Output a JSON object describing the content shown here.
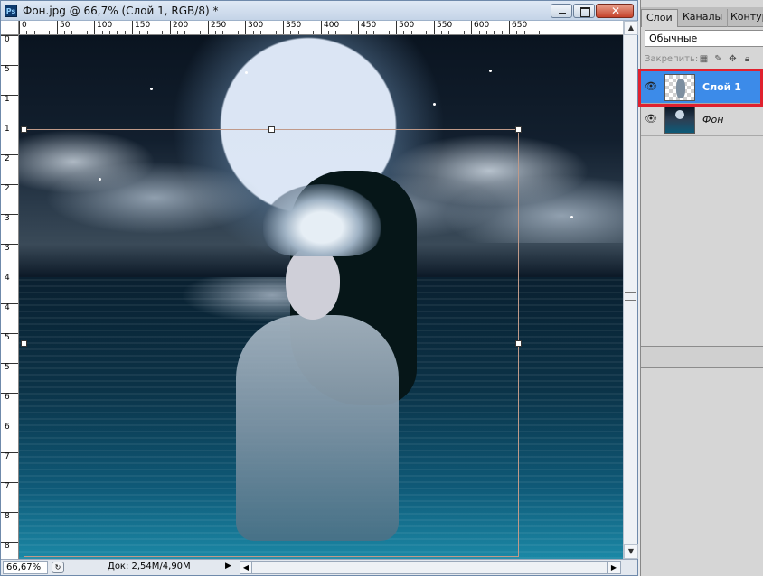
{
  "window": {
    "app_icon": "Ps",
    "title": "Фон.jpg @ 66,7% (Слой 1, RGB/8) *",
    "close_glyph": "✕"
  },
  "ruler": {
    "top_labels": [
      "0",
      "50",
      "100",
      "150",
      "200",
      "250",
      "300",
      "350",
      "400",
      "450",
      "500",
      "550",
      "600",
      "650"
    ],
    "left_labels": [
      "0",
      "5",
      "1",
      "1",
      "2",
      "2",
      "3",
      "3",
      "4",
      "4",
      "5",
      "5",
      "6",
      "6",
      "7",
      "7",
      "8",
      "8"
    ]
  },
  "main": {
    "canvas": {
      "background_image": "fantasy-moon-sea-woman",
      "colors": {
        "transform_border": "#c09a8a"
      }
    }
  },
  "status": {
    "zoom": "66,67%",
    "doc_info": "Док: 2,54M/4,90M",
    "menu_arrow": "▶",
    "scroll_left": "◀",
    "scroll_right": "▶",
    "scroll_up": "▲",
    "scroll_down": "▼"
  },
  "panel": {
    "tabs": [
      "Слои",
      "Каналы",
      "Контуры"
    ],
    "blend_mode": "Обычные",
    "lock_label": "Закрепить:",
    "lock_icons": [
      "transparency-lock-icon",
      "brush-lock-icon",
      "move-lock-icon",
      "padlock-icon"
    ],
    "layers": [
      {
        "name": "Слой 1",
        "selected": true,
        "visible": true
      },
      {
        "name": "Фон",
        "selected": false,
        "visible": true
      }
    ],
    "colors": {
      "selected_row": "#3c8be9",
      "annotation": "#e0212e"
    }
  }
}
